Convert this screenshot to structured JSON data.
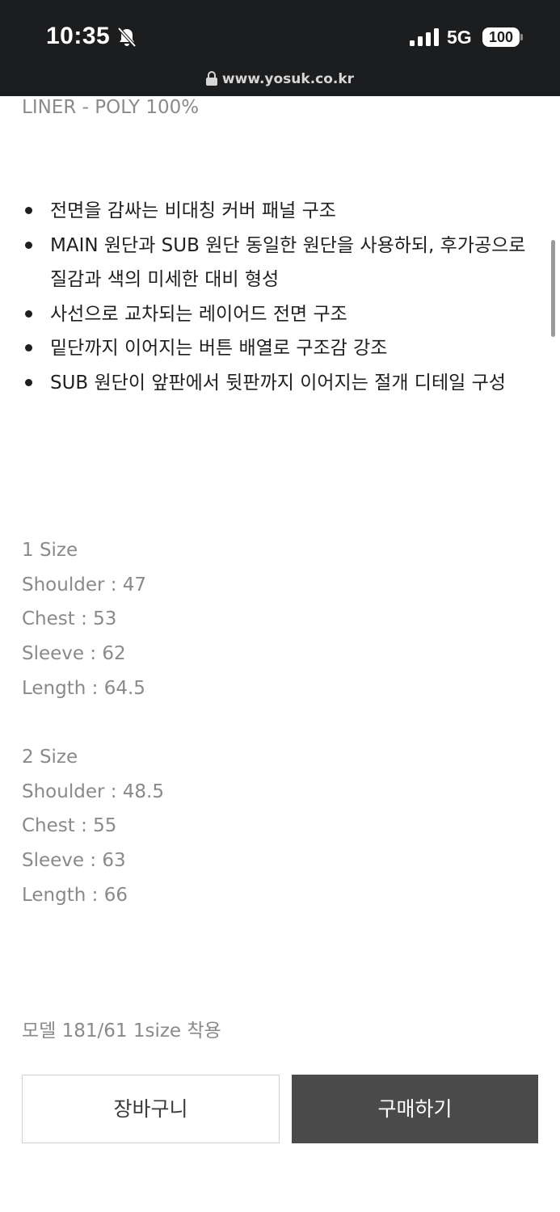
{
  "status_bar": {
    "time": "10:35",
    "network": "5G",
    "battery": "100",
    "url": "www.yosuk.co.kr",
    "icons": [
      "mute-icon",
      "signal-icon",
      "lock-icon"
    ]
  },
  "content": {
    "liner": "LINER - POLY 100%",
    "bullets": [
      "전면을 감싸는 비대칭 커버 패널 구조",
      "MAIN 원단과 SUB 원단 동일한 원단을 사용하되, 후가공으로 질감과 색의 미세한 대비 형성",
      "사선으로 교차되는 레이어드 전면 구조",
      "밑단까지 이어지는 버튼 배열로 구조감 강조",
      "SUB 원단이 앞판에서 뒷판까지 이어지는 절개 디테일 구성"
    ],
    "sizes": [
      {
        "title": "1 Size",
        "shoulder": "Shoulder : 47",
        "chest": "Chest : 53",
        "sleeve": "Sleeve : 62",
        "length": "Length : 64.5"
      },
      {
        "title": "2 Size",
        "shoulder": "Shoulder : 48.5",
        "chest": "Chest : 55",
        "sleeve": "Sleeve : 63",
        "length": "Length : 66"
      }
    ],
    "model_note": "모델 181/61 1size 착용"
  },
  "bottom_bar": {
    "cart_label": "장바구니",
    "buy_label": "구매하기"
  }
}
